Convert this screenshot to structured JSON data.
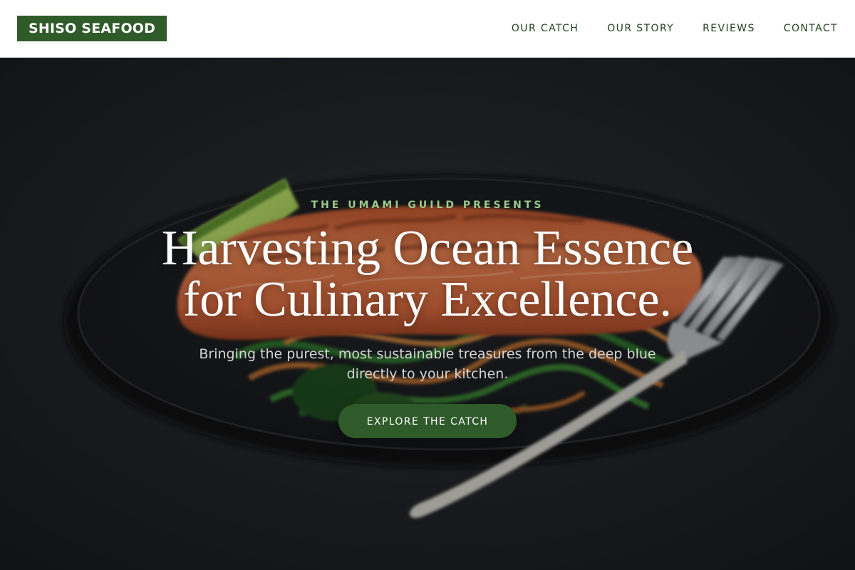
{
  "header": {
    "logo_text": "SHISO SEAFOOD",
    "nav": [
      {
        "label": "OUR CATCH"
      },
      {
        "label": "OUR STORY"
      },
      {
        "label": "REVIEWS"
      },
      {
        "label": "CONTACT"
      }
    ]
  },
  "hero": {
    "eyebrow": "THE UMAMI GUILD PRESENTS",
    "headline_line1": "Harvesting Ocean Essence",
    "headline_line2": "for Culinary Excellence.",
    "subtext": "Bringing the purest, most sustainable treasures from the deep blue directly to your kitchen.",
    "cta_label": "EXPLORE THE CATCH",
    "image_subject": "grilled salmon fillet on vegetable noodles with lime wedge and fork on dark plate"
  },
  "colors": {
    "brand_green": "#2f5a2a",
    "nav_text": "#234321",
    "eyebrow_green": "#9bc98c",
    "hero_background": "#181b1d"
  }
}
